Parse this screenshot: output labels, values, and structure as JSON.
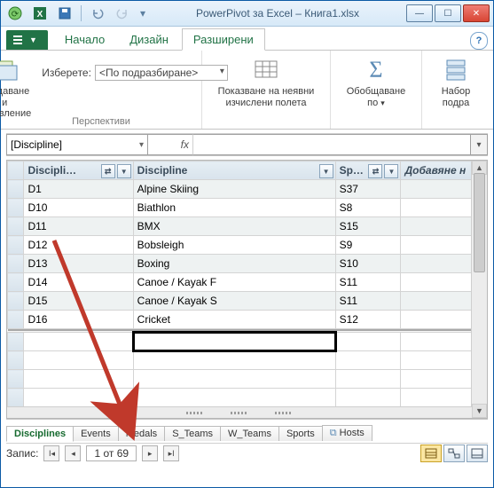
{
  "window": {
    "title": "PowerPivot за Excel – Книга1.xlsx"
  },
  "ribbon": {
    "file_label": "",
    "tabs": [
      {
        "label": "Начало"
      },
      {
        "label": "Дизайн"
      },
      {
        "label": "Разширени"
      }
    ],
    "active_tab_index": 2,
    "groups": {
      "perspectives": {
        "create_btn": "Създаване и\nуправление",
        "select_label": "Изберете:",
        "select_value": "<По подразбиране>",
        "group_label": "Перспективи"
      },
      "implicit": {
        "label": "Показване на неявни\nизчислени полета"
      },
      "summarize": {
        "label": "Обобщаване\nпо"
      },
      "set": {
        "label": "Набор\nподра"
      }
    }
  },
  "formula_bar": {
    "name_box": "[Discipline]",
    "fx": "fx",
    "formula": ""
  },
  "grid": {
    "headers": [
      "Discipli…",
      "Discipline",
      "Sp…",
      ""
    ],
    "add_column_label": "Добавяне н",
    "rows": [
      {
        "a": "D1",
        "b": "Alpine Skiing",
        "c": "S37"
      },
      {
        "a": "D10",
        "b": "Biathlon",
        "c": "S8"
      },
      {
        "a": "D11",
        "b": "BMX",
        "c": "S15"
      },
      {
        "a": "D12",
        "b": "Bobsleigh",
        "c": "S9"
      },
      {
        "a": "D13",
        "b": "Boxing",
        "c": "S10"
      },
      {
        "a": "D14",
        "b": "Canoe / Kayak F",
        "c": "S11"
      },
      {
        "a": "D15",
        "b": "Canoe / Kayak S",
        "c": "S11"
      },
      {
        "a": "D16",
        "b": "Cricket",
        "c": "S12"
      }
    ]
  },
  "sheets": [
    "Disciplines",
    "Events",
    "Medals",
    "S_Teams",
    "W_Teams",
    "Sports",
    "Hosts"
  ],
  "active_sheet_index": 0,
  "record_nav": {
    "label": "Запис:",
    "position": "1 от 69"
  },
  "colors": {
    "accent_green": "#217346"
  }
}
